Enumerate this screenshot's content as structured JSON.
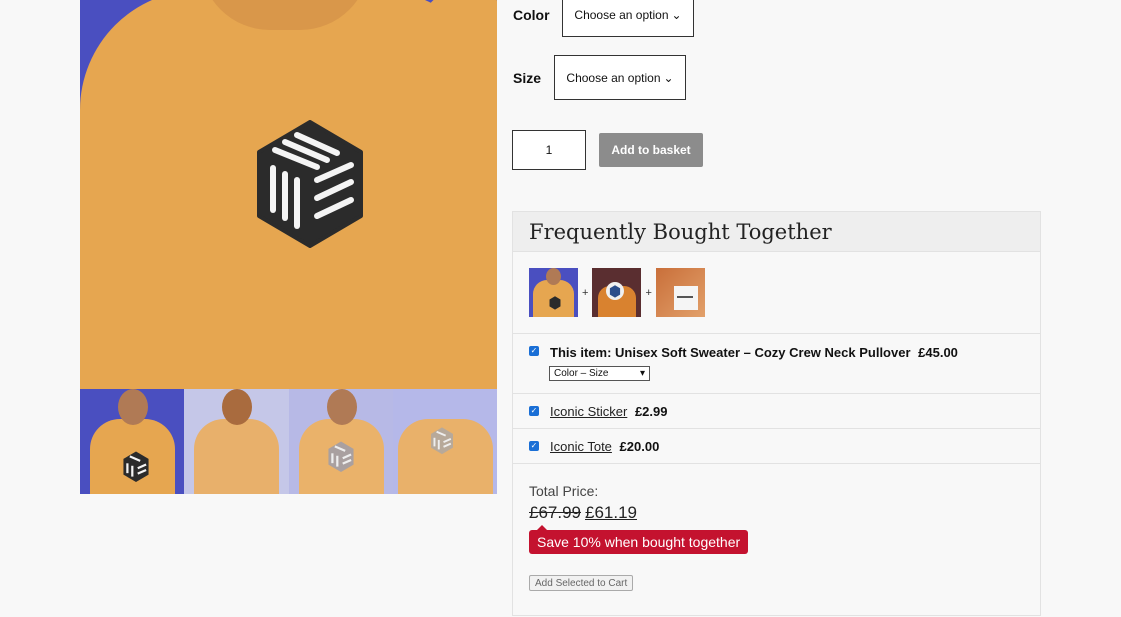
{
  "form": {
    "color_label": "Color",
    "color_value": "Choose an option",
    "size_label": "Size",
    "size_value": "Choose an option",
    "quantity": "1",
    "add_to_basket": "Add to basket"
  },
  "fbt": {
    "title": "Frequently Bought Together",
    "plus": "+",
    "items": [
      {
        "prefix": "This item: ",
        "name": "Unisex Soft Sweater – Cozy Crew Neck Pullover",
        "price": "£45.00",
        "checked": true,
        "variant": "Color – Size"
      },
      {
        "name": "Iconic Sticker",
        "price": "£2.99",
        "checked": true
      },
      {
        "name": "Iconic Tote",
        "price": "£20.00",
        "checked": true
      }
    ],
    "total_label": "Total Price:",
    "old_price": "£67.99",
    "new_price": "£61.19",
    "save_text": "Save 10% when bought together",
    "add_selected": "Add Selected to Cart"
  },
  "colors": {
    "accent_red": "#c4122f",
    "brand_blue": "#4a4fc0",
    "sweater": "#e6a650"
  }
}
